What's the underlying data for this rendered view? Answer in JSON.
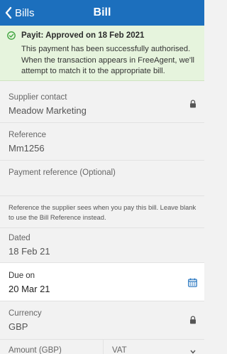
{
  "nav": {
    "back_label": "Bills",
    "title": "Bill"
  },
  "banner": {
    "title": "Payit: Approved on 18 Feb 2021",
    "text": "This payment has been successfully authorised. When the transaction appears in FreeAgent, we'll attempt to match it to the appropriate bill.",
    "color": "#e6f4dd"
  },
  "fields": {
    "supplier_contact": {
      "label": "Supplier contact",
      "value": "Meadow Marketing"
    },
    "reference": {
      "label": "Reference",
      "value": "Mm1256"
    },
    "payment_reference": {
      "label": "Payment reference (Optional)",
      "value": ""
    },
    "payment_reference_help": "Reference the supplier sees when you pay this bill. Leave blank to use the Bill Reference instead.",
    "dated": {
      "label": "Dated",
      "value": "18 Feb 21"
    },
    "due_on": {
      "label": "Due on",
      "value": "20 Mar 21"
    },
    "currency": {
      "label": "Currency",
      "value": "GBP"
    },
    "amount": {
      "label": "Amount (GBP)"
    },
    "vat": {
      "label": "VAT"
    }
  },
  "colors": {
    "nav": "#1c6fbd",
    "accent": "#1c6fbd",
    "success": "#3aa23a"
  }
}
